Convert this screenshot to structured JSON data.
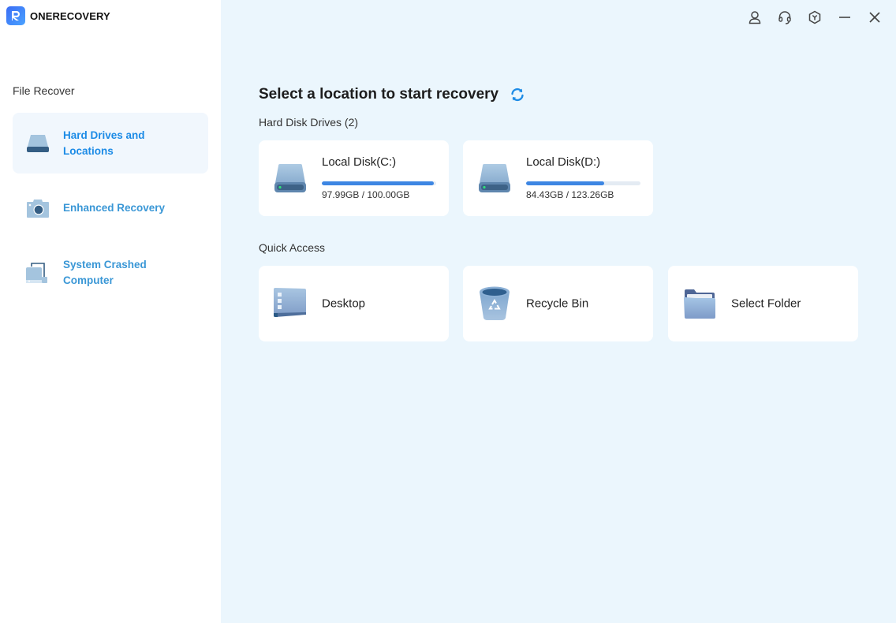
{
  "app": {
    "name": "ONERECOVERY",
    "brand_color": "#3A6CF5",
    "accent_color": "#1C8BE6"
  },
  "window_controls": [
    {
      "name": "account",
      "icon": "user-icon"
    },
    {
      "name": "support",
      "icon": "headset-icon"
    },
    {
      "name": "settings",
      "icon": "hexagon-icon"
    },
    {
      "name": "minimize",
      "icon": "minimize-icon"
    },
    {
      "name": "close",
      "icon": "close-icon"
    }
  ],
  "sidebar": {
    "section_label": "File Recover",
    "items": [
      {
        "label": "Hard Drives and Locations",
        "icon": "hard-drive-icon",
        "active": true
      },
      {
        "label": "Enhanced Recovery",
        "icon": "camera-icon",
        "active": false
      },
      {
        "label": "System Crashed Computer",
        "icon": "crashed-computer-icon",
        "active": false
      }
    ]
  },
  "main": {
    "title": "Select a location to start recovery",
    "refresh_icon": "refresh-icon",
    "hard_disks": {
      "label": "Hard Disk Drives (2)",
      "items": [
        {
          "name": "Local Disk(C:)",
          "used": "97.99GB",
          "total": "100.00GB",
          "size_text": "97.99GB / 100.00GB",
          "used_fraction": 0.98
        },
        {
          "name": "Local Disk(D:)",
          "used": "84.43GB",
          "total": "123.26GB",
          "size_text": "84.43GB / 123.26GB",
          "used_fraction": 0.685
        }
      ]
    },
    "quick_access": {
      "label": "Quick Access",
      "items": [
        {
          "label": "Desktop",
          "icon": "desktop-icon"
        },
        {
          "label": "Recycle Bin",
          "icon": "recycle-bin-icon"
        },
        {
          "label": "Select Folder",
          "icon": "folder-icon"
        }
      ]
    }
  }
}
